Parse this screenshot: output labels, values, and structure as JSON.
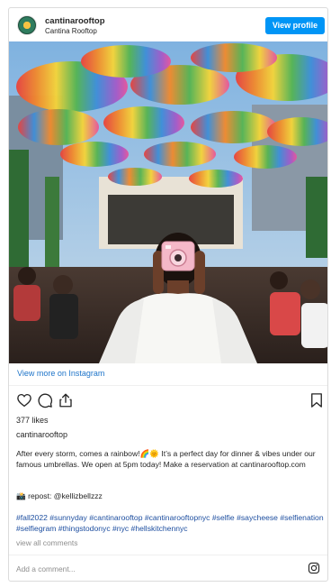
{
  "header": {
    "username": "cantinarooftop",
    "location": "Cantina Rooftop",
    "view_profile_label": "View profile"
  },
  "post": {
    "image_alt": "Woman in white shirt holding pink instant camera under rainbow umbrellas at rooftop bar",
    "view_more_label": "View more on Instagram"
  },
  "actions": {
    "icons": [
      "heart-icon",
      "comment-icon",
      "share-icon",
      "bookmark-icon"
    ]
  },
  "likes": "377 likes",
  "caption": {
    "username": "cantinarooftop",
    "text": "After every storm, comes a rainbow!🌈🌞 It’s a perfect day for dinner & vibes under our famous umbrellas. We open at 5pm today! Make a reservation at cantinarooftop.com",
    "repost": "📸 repost: @kellizbellzzz",
    "hashtags": "#fall2022 #sunnyday #cantinarooftop #cantinarooftopnyc #selfie #saycheese #selfienation #selfiegram #thingstodonyc #nyc #hellskitchennyc"
  },
  "view_all_comments": "view all comments",
  "add_comment_placeholder": "Add a comment...",
  "colors": {
    "accent": "#0095f6",
    "link": "#1e74c9",
    "muted": "#8e8e8e"
  }
}
